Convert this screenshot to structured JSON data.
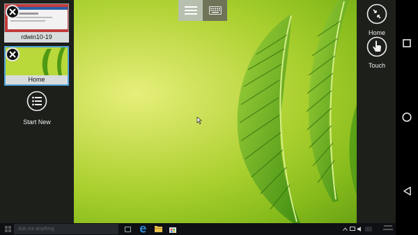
{
  "sessions": [
    {
      "label": "rdwin10-19",
      "close_icon": "close-icon"
    },
    {
      "label": "Home",
      "close_icon": "close-icon",
      "selected": true
    }
  ],
  "start_new": {
    "label": "Start New",
    "icon": "list-icon"
  },
  "right_controls": [
    {
      "label": "Home",
      "icon": "minimize-arrows-icon"
    },
    {
      "label": "Touch",
      "icon": "touch-hand-icon"
    }
  ],
  "toolbar": {
    "menu_icon": "hamburger-icon",
    "keyboard_icon": "keyboard-icon"
  },
  "android_nav": [
    "recents-square-icon",
    "home-circle-icon",
    "back-triangle-icon"
  ],
  "taskbar": {
    "search_placeholder": "Ask me anything",
    "pinned": [
      "task-view-icon",
      "edge-icon",
      "file-explorer-icon",
      "store-icon"
    ]
  },
  "colors": {
    "panel_bg": "#1d1f1b",
    "selected_border": "#4fa3d9",
    "wallpaper": "#a8cf2d"
  }
}
